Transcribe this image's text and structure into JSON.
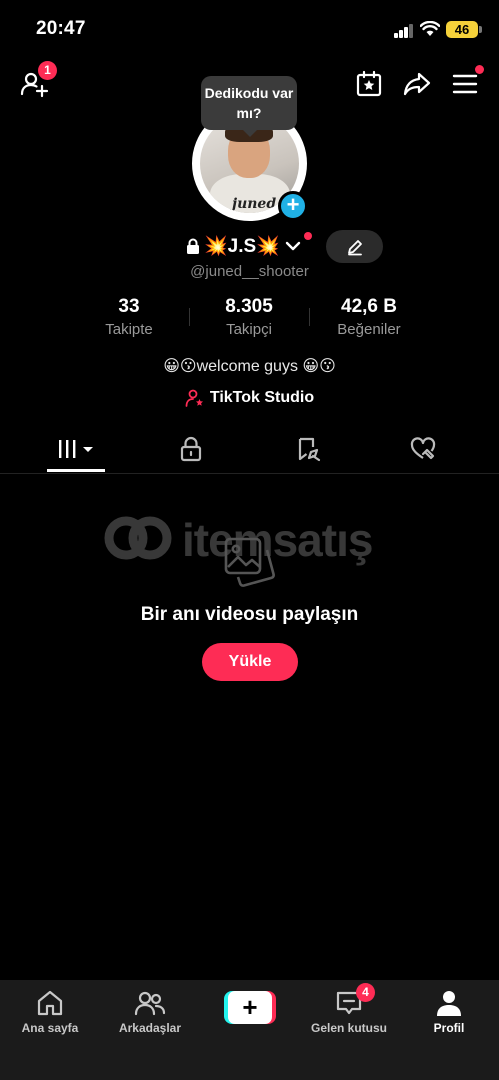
{
  "status_bar": {
    "time": "20:47",
    "battery": "46"
  },
  "header": {
    "add_friend_badge": "1",
    "tooltip": "Dedikodu var mı?"
  },
  "avatar_signature": "juned",
  "profile": {
    "display_name": "💥J.S💥",
    "username": "@juned__shooter",
    "stats": [
      {
        "value": "33",
        "label": "Takipte"
      },
      {
        "value": "8.305",
        "label": "Takipçi"
      },
      {
        "value": "42,6 B",
        "label": "Beğeniler"
      }
    ],
    "bio": "😀😗welcome guys   😀😗",
    "studio_link": "TikTok Studio"
  },
  "tabs": [
    {
      "icon": "grid-icon",
      "active": true
    },
    {
      "icon": "lock-icon"
    },
    {
      "icon": "saved-icon"
    },
    {
      "icon": "liked-icon"
    }
  ],
  "watermark": {
    "text": "itemsatış"
  },
  "empty_state": {
    "message": "Bir anı videosu paylaşın",
    "button": "Yükle"
  },
  "bottom_nav": [
    {
      "label": "Ana sayfa",
      "icon": "home-icon"
    },
    {
      "label": "Arkadaşlar",
      "icon": "friends-icon"
    },
    {
      "label": "",
      "icon": "create-icon"
    },
    {
      "label": "Gelen kutusu",
      "icon": "inbox-icon",
      "badge": "4"
    },
    {
      "label": "Profil",
      "icon": "profile-icon",
      "active": true
    }
  ],
  "colors": {
    "accent": "#fe2c55",
    "cyan": "#25f4ee",
    "add_avatar": "#20b1e6"
  }
}
